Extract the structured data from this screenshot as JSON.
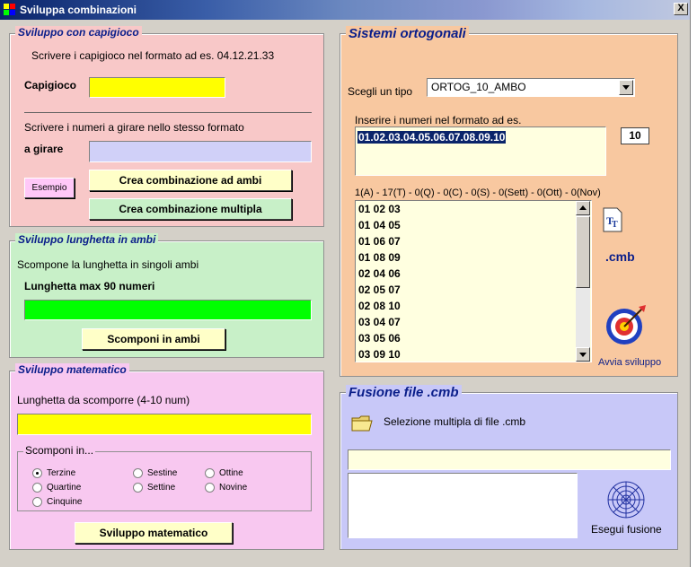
{
  "window": {
    "title": "Sviluppa combinazioni",
    "close_label": "X"
  },
  "capigioco": {
    "legend": "Sviluppo con capigioco",
    "instructions": "Scrivere i capigioco nel formato ad es. 04.12.21.33",
    "capigioco_label": "Capigioco",
    "capigioco_value": "",
    "girare_instructions": "Scrivere i numeri a girare nello stesso formato",
    "girare_label": "a girare",
    "girare_value": "",
    "esempio_button": "Esempio",
    "ambi_button": "Crea combinazione ad ambi",
    "multipla_button": "Crea combinazione multipla",
    "bg_color": "#f8c8c8"
  },
  "lunghetta": {
    "legend": "Sviluppo lunghetta in ambi",
    "description": "Scompone la lunghetta in singoli ambi",
    "max_label": "Lunghetta max 90 numeri",
    "value": "",
    "button": "Scomponi in ambi",
    "bg_color": "#c8f0c8",
    "field_color": "#00ff00"
  },
  "matematico": {
    "legend": "Sviluppo matematico",
    "label": "Lunghetta da scomporre (4-10 num)",
    "value": "",
    "group_label": "Scomponi in...",
    "options": [
      {
        "label": "Terzine",
        "selected": true
      },
      {
        "label": "Quartine",
        "selected": false
      },
      {
        "label": "Cinquine",
        "selected": false
      },
      {
        "label": "Sestine",
        "selected": false
      },
      {
        "label": "Settine",
        "selected": false
      },
      {
        "label": "Ottine",
        "selected": false
      },
      {
        "label": "Novine",
        "selected": false
      }
    ],
    "button": "Sviluppo matematico",
    "bg_color": "#f8c8f0"
  },
  "ortogonali": {
    "legend": "Sistemi ortogonali",
    "tipo_label": "Scegli un tipo",
    "tipo_value": "ORTOG_10_AMBO",
    "input_label": "Inserire i numeri nel formato ad es.",
    "numbers_value": "01.02.03.04.05.06.07.08.09.10",
    "count": "10",
    "summary": "1(A) - 17(T) - 0(Q) - 0(C) - 0(S) - 0(Sett) - 0(Ott) - 0(Nov)",
    "combinations": [
      "01 02 03",
      "01 04 05",
      "01 06 07",
      "01 08 09",
      "02 04 06",
      "02 05 07",
      "02 08 10",
      "03 04 07",
      "03 05 06",
      "03 09 10"
    ],
    "cmb_label": ".cmb",
    "avvia_label": "Avvia sviluppo",
    "bg_color": "#f8c8a0"
  },
  "fusione": {
    "legend": "Fusione file .cmb",
    "selezione_label": "Selezione multipla di file .cmb",
    "path_value": "",
    "esegui_label": "Esegui fusione",
    "bg_color": "#c8c8f8"
  }
}
